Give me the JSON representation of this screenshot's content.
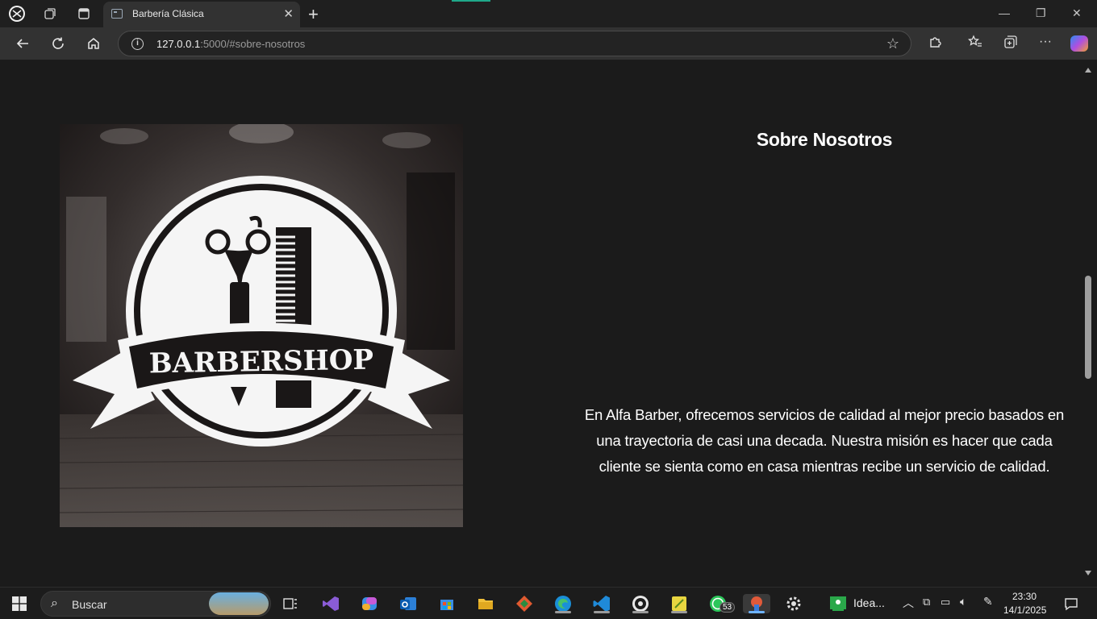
{
  "browser": {
    "tab_title": "Barbería Clásica",
    "url_host": "127.0.0.1",
    "url_rest": ":5000/#sobre-nosotros"
  },
  "about": {
    "title": "Sobre Nosotros",
    "text": "En Alfa Barber, ofrecemos servicios de calidad al mejor precio basados en una trayectoria de casi una decada. Nuestra misión es hacer que cada cliente se sienta como en casa mientras recibe un servicio de calidad.",
    "logo_text": "BARBERSHOP"
  },
  "taskbar": {
    "search_label": "Buscar",
    "whatsapp_badge": "53",
    "idea_label": "Idea...",
    "time": "23:30",
    "date": "14/1/2025"
  }
}
